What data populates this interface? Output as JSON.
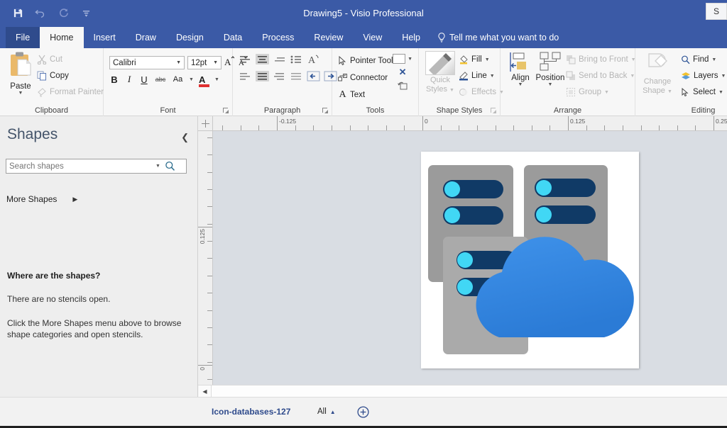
{
  "window": {
    "title": "Drawing5  -  Visio Professional",
    "quick_access": [
      {
        "name": "save-icon",
        "label": "Save"
      },
      {
        "name": "undo-icon",
        "label": "Undo"
      },
      {
        "name": "redo-icon",
        "label": "Redo"
      },
      {
        "name": "customize-qat-icon",
        "label": "Customize Quick Access Toolbar"
      }
    ],
    "corner_label": "S"
  },
  "ribbon": {
    "tabs": [
      {
        "label": "File",
        "active": false,
        "style": "file"
      },
      {
        "label": "Home",
        "active": true,
        "style": "normal"
      },
      {
        "label": "Insert",
        "active": false,
        "style": "normal"
      },
      {
        "label": "Draw",
        "active": false,
        "style": "normal"
      },
      {
        "label": "Design",
        "active": false,
        "style": "normal"
      },
      {
        "label": "Data",
        "active": false,
        "style": "normal"
      },
      {
        "label": "Process",
        "active": false,
        "style": "normal"
      },
      {
        "label": "Review",
        "active": false,
        "style": "normal"
      },
      {
        "label": "View",
        "active": false,
        "style": "normal"
      },
      {
        "label": "Help",
        "active": false,
        "style": "normal"
      }
    ],
    "tell_me": "Tell me what you want to do",
    "groups": {
      "clipboard": {
        "label": "Clipboard",
        "paste": "Paste",
        "cut": "Cut",
        "copy": "Copy",
        "format_painter": "Format Painter"
      },
      "font": {
        "label": "Font",
        "font_name": "Calibri",
        "font_size": "12pt",
        "bold": "B",
        "italic": "I",
        "underline": "U",
        "strikethrough": "abc",
        "change_case": "Aa",
        "font_color": "A"
      },
      "paragraph": {
        "label": "Paragraph"
      },
      "tools": {
        "label": "Tools",
        "pointer_tool": "Pointer Tool",
        "connector": "Connector",
        "text": "Text"
      },
      "shape_styles": {
        "label": "Shape Styles",
        "quick_styles": "Quick Styles",
        "fill": "Fill",
        "line": "Line",
        "effects": "Effects"
      },
      "arrange": {
        "label": "Arrange",
        "align": "Align",
        "position": "Position",
        "bring_to_front": "Bring to Front",
        "send_to_back": "Send to Back",
        "group": "Group"
      },
      "change_shape": {
        "label_line1": "Change",
        "label_line2": "Shape"
      },
      "editing": {
        "label": "Editing",
        "find": "Find",
        "layers": "Layers",
        "select": "Select"
      }
    }
  },
  "shapes_panel": {
    "title": "Shapes",
    "search_placeholder": "Search shapes",
    "search_value": "",
    "more_shapes": "More Shapes",
    "help_heading": "Where are the shapes?",
    "help_line1": "There are no stencils open.",
    "help_line2": "Click the More Shapes menu above to browse shape categories and open stencils."
  },
  "rulers": {
    "horizontal_labels": [
      "-0.125",
      "0",
      "0.125",
      "0.25"
    ],
    "vertical_labels": [
      "0.125",
      "0"
    ]
  },
  "canvas": {
    "artwork_name": "databases-cloud-icon",
    "colors": {
      "server_back": "#9b9b9b",
      "server_front": "#aaaaaa",
      "pill_dark": "#103a66",
      "led_cyan": "#41d7f5",
      "cloud_blue": "#3083e0",
      "page_white": "#ffffff",
      "canvas_gray": "#d9dde3"
    }
  },
  "pagebar": {
    "page_tab": "Icon-databases-127",
    "all_label": "All",
    "add_page_title": "Insert Page"
  }
}
